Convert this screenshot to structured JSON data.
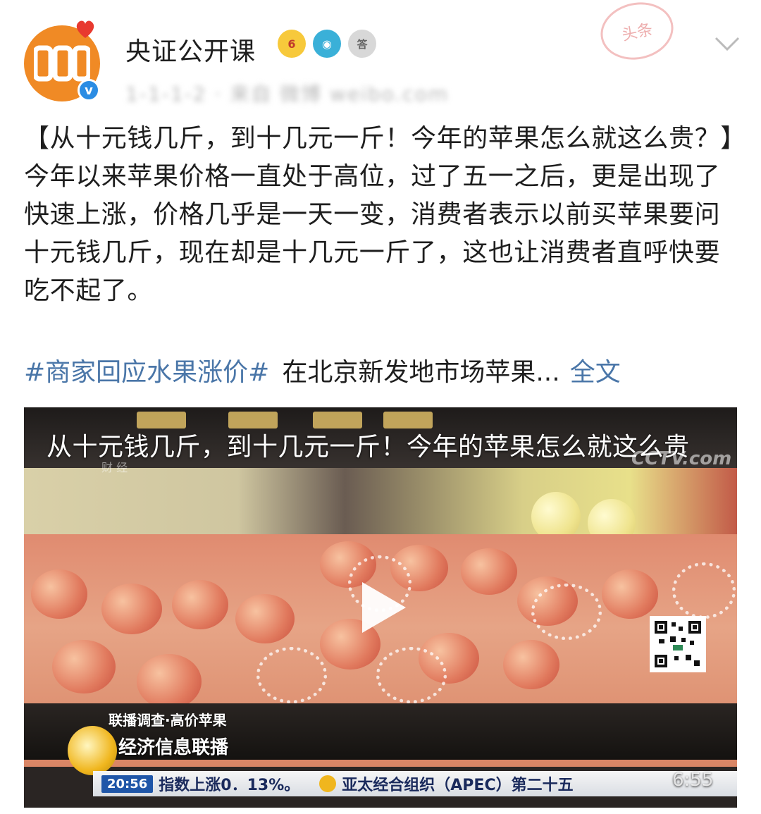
{
  "header": {
    "account_name": "央证公开课",
    "meta_text": "1-1-1-2 · 来自 微博 weibo.com",
    "stamp_text": "头条",
    "verified_mark": "v",
    "badges": [
      {
        "name": "crown-badge",
        "text": "6"
      },
      {
        "name": "camera-badge",
        "text": "◉"
      },
      {
        "name": "medal-badge",
        "text": "答"
      }
    ]
  },
  "post": {
    "text": "【从十元钱几斤，到十几元一斤！今年的苹果怎么就这么贵？】今年以来苹果价格一直处于高位，过了五一之后，更是出现了快速上涨，价格几乎是一天一变，消费者表示以前买苹果要问十元钱几斤，现在却是十几元一斤了，这也让消费者直呼快要吃不起了。",
    "hashtag": "#商家回应水果涨价#",
    "topic_text": "在北京新发地市场苹果...",
    "full_text_link": "全文"
  },
  "video": {
    "title": "从十元钱几斤，到十几元一斤！今年的苹果怎么就这么贵",
    "watermark": "CCTV.com",
    "caiji": "财 经",
    "segment_label": "联播调查·高价苹果",
    "channel_name": "经济信息联播",
    "ticker_time": "20:56",
    "ticker_left": "指数上涨0．13%。",
    "ticker_right": "亚太经合组织（APEC）第二十五",
    "duration": "6:55"
  },
  "colors": {
    "link": "#4a76a8",
    "avatar_orange": "#f08a25",
    "verified_blue": "#2b8ce3"
  }
}
